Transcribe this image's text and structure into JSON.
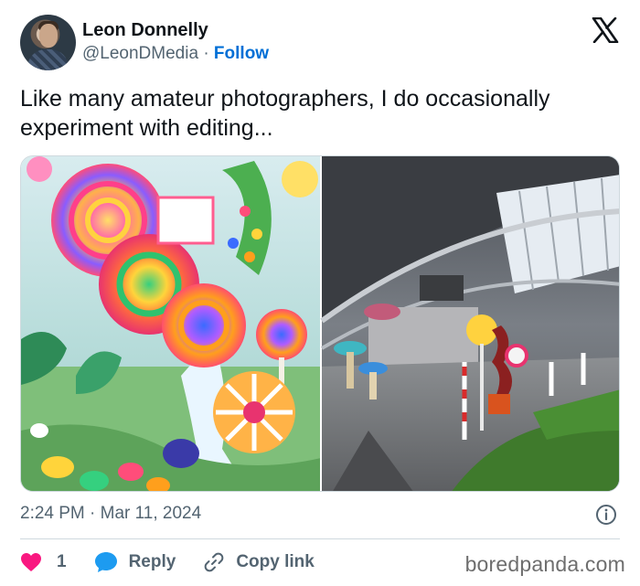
{
  "author": {
    "name": "Leon Donnelly",
    "handle": "@LeonDMedia",
    "separator": "·",
    "follow_label": "Follow"
  },
  "tweet": {
    "text": "Like many amateur photographers, I do occasionally experiment with editing..."
  },
  "footer": {
    "timestamp": "2:24 PM · Mar 11, 2024"
  },
  "actions": {
    "like_count": "1",
    "reply_label": "Reply",
    "copy_label": "Copy link"
  },
  "watermark": "boredpanda.com",
  "icons": {
    "logo": "x-logo-icon",
    "info": "info-icon",
    "like": "heart-icon",
    "reply": "speech-bubble-icon",
    "copy": "link-icon"
  },
  "colors": {
    "accent": "#006fd6",
    "like": "#f91880",
    "reply": "#1d9bf0",
    "muted": "#536471"
  }
}
